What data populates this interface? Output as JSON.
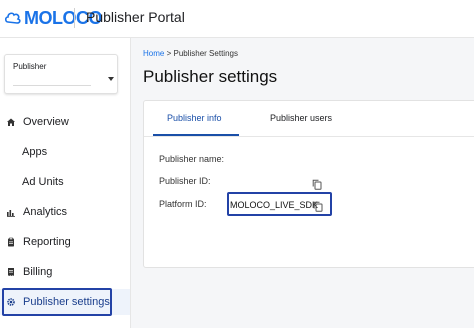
{
  "header": {
    "logo_text": "MOLOCO",
    "portal_title": "Publisher Portal"
  },
  "sidebar": {
    "publisher_select": {
      "label": "Publisher",
      "value": ""
    },
    "items": [
      {
        "label": "Overview",
        "icon": "home-icon"
      },
      {
        "label": "Apps",
        "icon": ""
      },
      {
        "label": "Ad Units",
        "icon": ""
      },
      {
        "label": "Analytics",
        "icon": "bar-chart-icon"
      },
      {
        "label": "Reporting",
        "icon": "clipboard-icon"
      },
      {
        "label": "Billing",
        "icon": "receipt-icon"
      },
      {
        "label": "Publisher settings",
        "icon": "gear-icon"
      }
    ],
    "active_item": "Publisher settings"
  },
  "main": {
    "breadcrumb": {
      "home": "Home",
      "separator": ">",
      "current": "Publisher Settings"
    },
    "page_title": "Publisher settings",
    "tabs": [
      {
        "label": "Publisher info",
        "active": true
      },
      {
        "label": "Publisher users",
        "active": false
      }
    ],
    "fields": {
      "publisher_name_label": "Publisher name:",
      "publisher_name_value": "",
      "publisher_id_label": "Publisher ID:",
      "publisher_id_value": "",
      "platform_id_label": "Platform ID:",
      "platform_id_value": "MOLOCO_LIVE_SDK"
    }
  },
  "colors": {
    "brand": "#1a73e8",
    "highlight_outline": "#2342a6",
    "active_tab": "#1a4fa8"
  }
}
